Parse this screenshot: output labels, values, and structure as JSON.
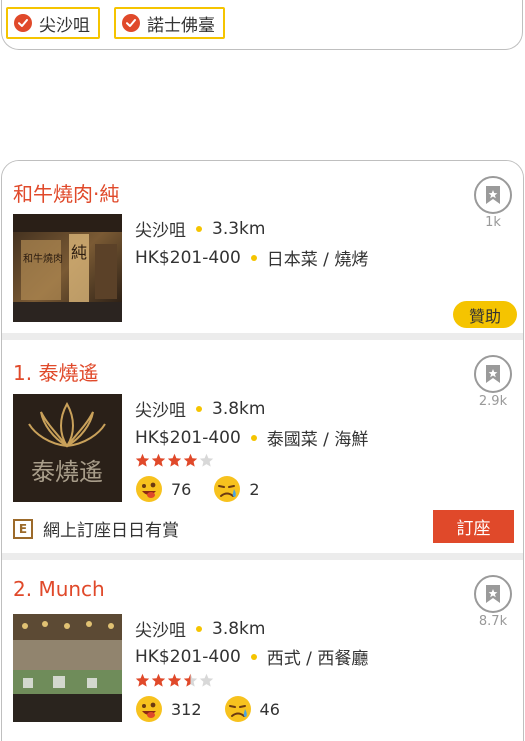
{
  "filters": [
    {
      "label": "尖沙咀"
    },
    {
      "label": "諾士佛臺"
    }
  ],
  "restaurants": [
    {
      "title": "和牛燒肉·純",
      "district": "尖沙咀",
      "distance": "3.3km",
      "price": "HK$201-400",
      "cuisine": "日本菜 / 燒烤",
      "bookmarks": "1k",
      "sponsor_label": "贊助"
    },
    {
      "title": "1. 泰燒遙",
      "district": "尖沙咀",
      "distance": "3.8km",
      "price": "HK$201-400",
      "cuisine": "泰國菜 / 海鮮",
      "bookmarks": "2.9k",
      "rating": 4,
      "smile_count": "76",
      "cry_count": "2",
      "promo_text": "網上訂座日日有賞",
      "book_label": "訂座",
      "logo_text": "泰燒遙"
    },
    {
      "title": "2. Munch",
      "district": "尖沙咀",
      "distance": "3.8km",
      "price": "HK$201-400",
      "cuisine": "西式 / 西餐廳",
      "bookmarks": "8.7k",
      "rating": 3.5,
      "smile_count": "312",
      "cry_count": "46"
    }
  ],
  "colors": {
    "brand": "#e0492a",
    "accent": "#f5c400",
    "star_off": "#d8d8d8"
  }
}
